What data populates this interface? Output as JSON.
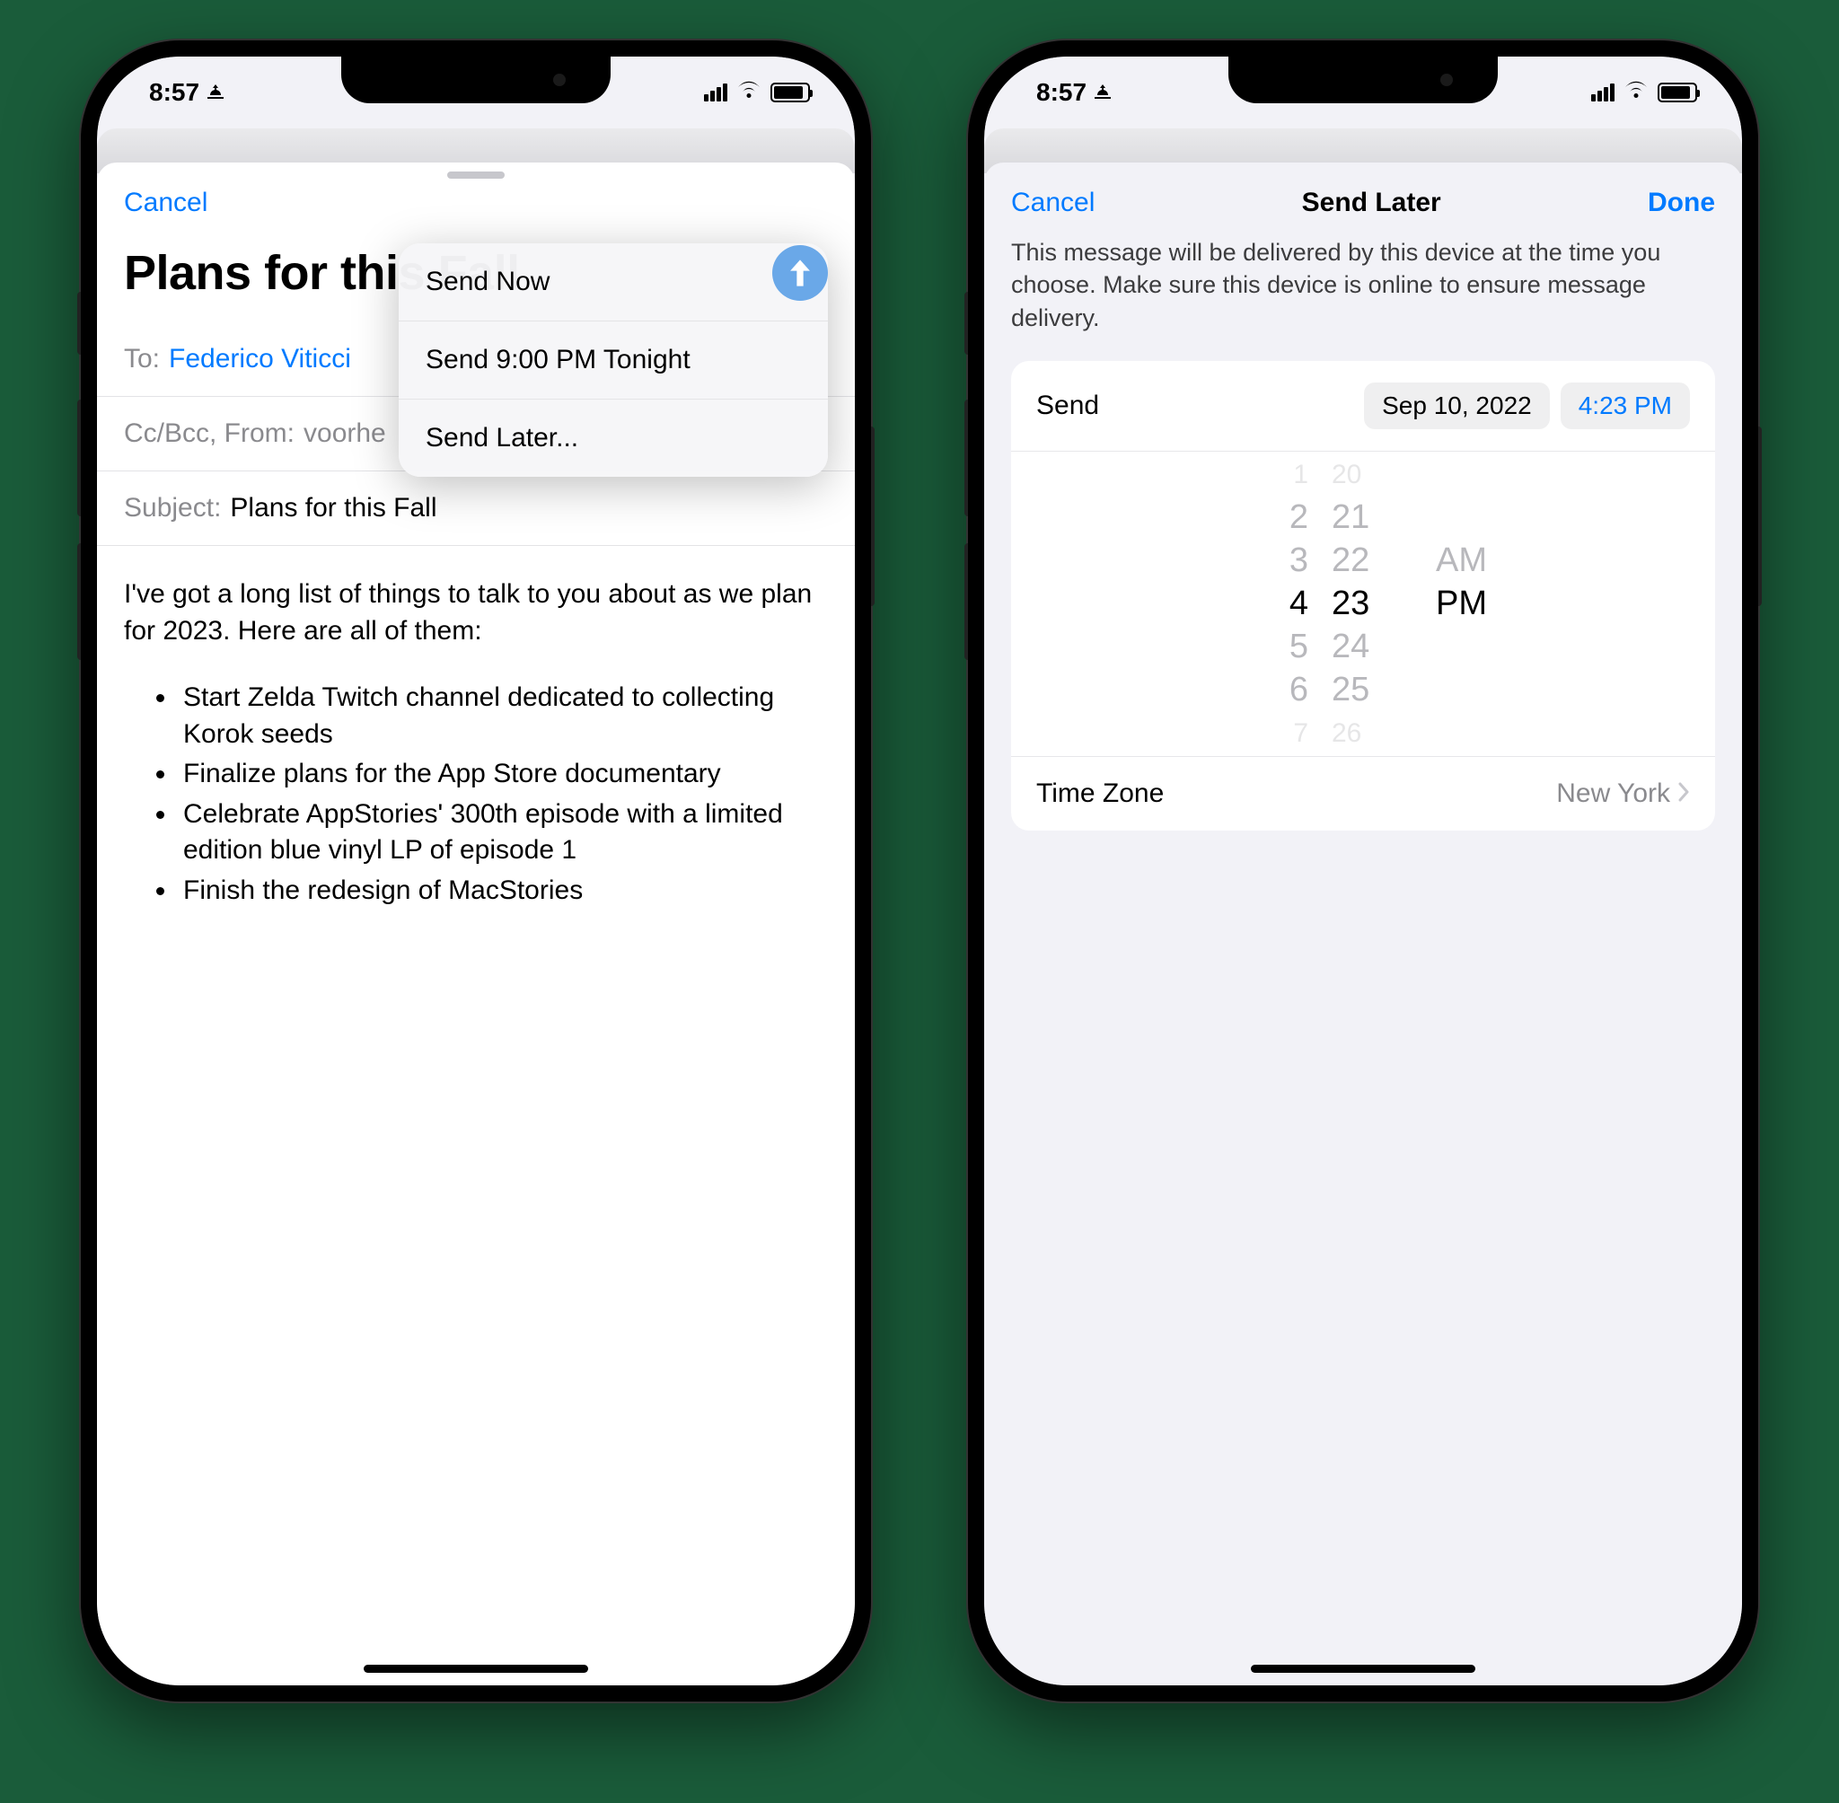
{
  "status": {
    "time": "8:57"
  },
  "left": {
    "nav": {
      "cancel": "Cancel"
    },
    "compose": {
      "title": "Plans for this Fall",
      "to_label": "To:",
      "to_value": "Federico Viticci",
      "ccbcc_label": "Cc/Bcc, From:",
      "ccbcc_value": "voorhe",
      "subject_label": "Subject:",
      "subject_value": "Plans for this Fall",
      "body_intro": "I've got a long list of things to talk to you about as we plan for 2023. Here are all of them:",
      "bullets": [
        "Start Zelda Twitch channel dedicated to collecting Korok seeds",
        "Finalize plans for the App Store documentary",
        "Celebrate AppStories' 300th episode with a limited edition blue vinyl LP of episode 1",
        "Finish the redesign of MacStories"
      ]
    },
    "popover": {
      "send_now": "Send Now",
      "send_tonight": "Send 9:00 PM Tonight",
      "send_later": "Send Later..."
    }
  },
  "right": {
    "nav": {
      "cancel": "Cancel",
      "title": "Send Later",
      "done": "Done"
    },
    "description": "This message will be delivered by this device at the time you choose. Make sure this device is online to ensure message delivery.",
    "send_label": "Send",
    "date_pill": "Sep 10, 2022",
    "time_pill": "4:23 PM",
    "tz_label": "Time Zone",
    "tz_value": "New York",
    "wheel": {
      "hours": [
        "1",
        "2",
        "3",
        "4",
        "5",
        "6",
        "7"
      ],
      "mins": [
        "20",
        "21",
        "22",
        "23",
        "24",
        "25",
        "26"
      ],
      "ampm": [
        "AM",
        "PM"
      ]
    }
  }
}
